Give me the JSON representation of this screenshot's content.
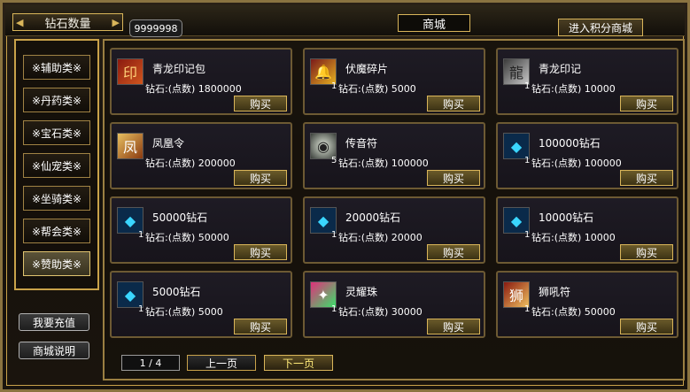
{
  "header": {
    "diamond_label": "钻石数量",
    "diamond_count": "9999998",
    "shop_title": "商城",
    "points_shop_button": "进入积分商城"
  },
  "categories": [
    {
      "label": "※辅助类※"
    },
    {
      "label": "※丹药类※"
    },
    {
      "label": "※宝石类※"
    },
    {
      "label": "※仙宠类※"
    },
    {
      "label": "※坐骑类※"
    },
    {
      "label": "※帮会类※"
    },
    {
      "label": "※赞助类※",
      "active": true
    }
  ],
  "side_buttons": {
    "recharge": "我要充值",
    "help": "商城说明"
  },
  "items": [
    {
      "name": "青龙印记包",
      "price": "钻石:(点数) 1800000",
      "qty": "",
      "icon": "dragon-seal-bag-icon",
      "buy": "购买"
    },
    {
      "name": "伏魔碎片",
      "price": "钻石:(点数) 5000",
      "qty": "1",
      "icon": "bell-fragment-icon",
      "buy": "购买"
    },
    {
      "name": "青龙印记",
      "price": "钻石:(点数) 10000",
      "qty": "1",
      "icon": "dragon-seal-icon",
      "buy": "购买"
    },
    {
      "name": "凤凰令",
      "price": "钻石:(点数) 200000",
      "qty": "",
      "icon": "phoenix-token-icon",
      "buy": "购买"
    },
    {
      "name": "传音符",
      "price": "钻石:(点数) 100000",
      "qty": "5",
      "icon": "sound-talisman-icon",
      "buy": "购买"
    },
    {
      "name": "100000钻石",
      "price": "钻石:(点数) 100000",
      "qty": "1",
      "icon": "diamond-icon",
      "buy": "购买"
    },
    {
      "name": "50000钻石",
      "price": "钻石:(点数) 50000",
      "qty": "1",
      "icon": "diamond-icon",
      "buy": "购买"
    },
    {
      "name": "20000钻石",
      "price": "钻石:(点数) 20000",
      "qty": "1",
      "icon": "diamond-icon",
      "buy": "购买"
    },
    {
      "name": "10000钻石",
      "price": "钻石:(点数) 10000",
      "qty": "1",
      "icon": "diamond-icon",
      "buy": "购买"
    },
    {
      "name": "5000钻石",
      "price": "钻石:(点数) 5000",
      "qty": "1",
      "icon": "diamond-icon",
      "buy": "购买"
    },
    {
      "name": "灵耀珠",
      "price": "钻石:(点数) 30000",
      "qty": "1",
      "icon": "spirit-pearl-icon",
      "buy": "购买"
    },
    {
      "name": "狮吼符",
      "price": "钻石:(点数) 50000",
      "qty": "1",
      "icon": "lion-roar-talisman-icon",
      "buy": "购买"
    }
  ],
  "pager": {
    "page": "1 / 4",
    "prev": "上一页",
    "next": "下一页"
  },
  "colors": {
    "gold_border": "#c9a24a",
    "card_bg": "#1e1b24",
    "diamond_blue": "#3ad6ff"
  }
}
